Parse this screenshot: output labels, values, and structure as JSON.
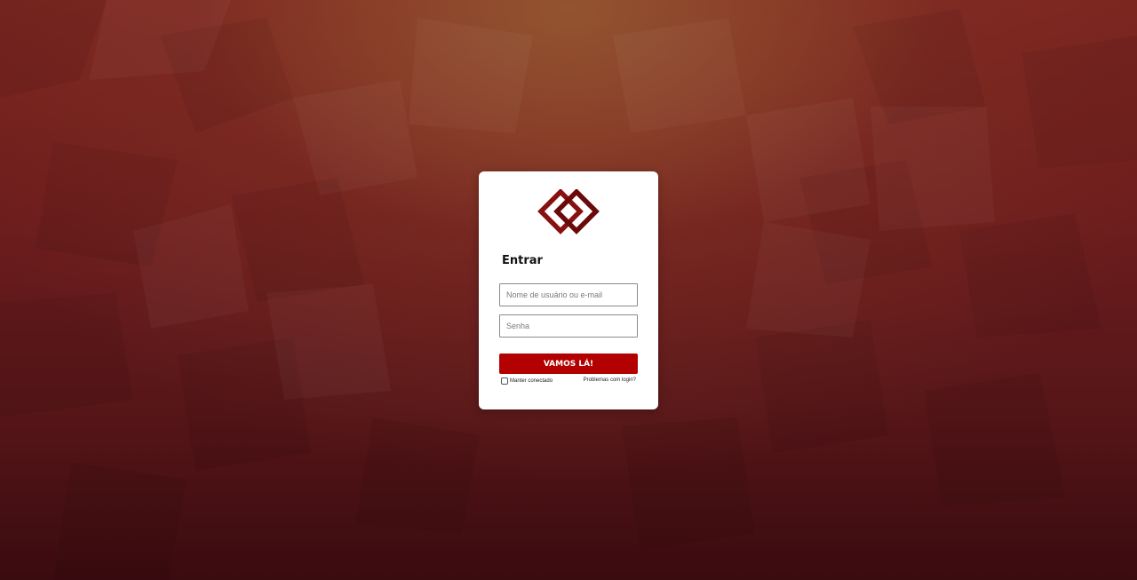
{
  "login": {
    "title": "Entrar",
    "username_placeholder": "Nome de usuário ou e-mail",
    "password_placeholder": "Senha",
    "submit_label": "VAMOS LÁ!",
    "remember_label": "Manter conectado",
    "trouble_link": "Problemas com login?"
  },
  "colors": {
    "accent": "#b30000",
    "logo": "#7a0c0c"
  },
  "icons": {
    "logo": "interlocked-diamonds-logo"
  }
}
